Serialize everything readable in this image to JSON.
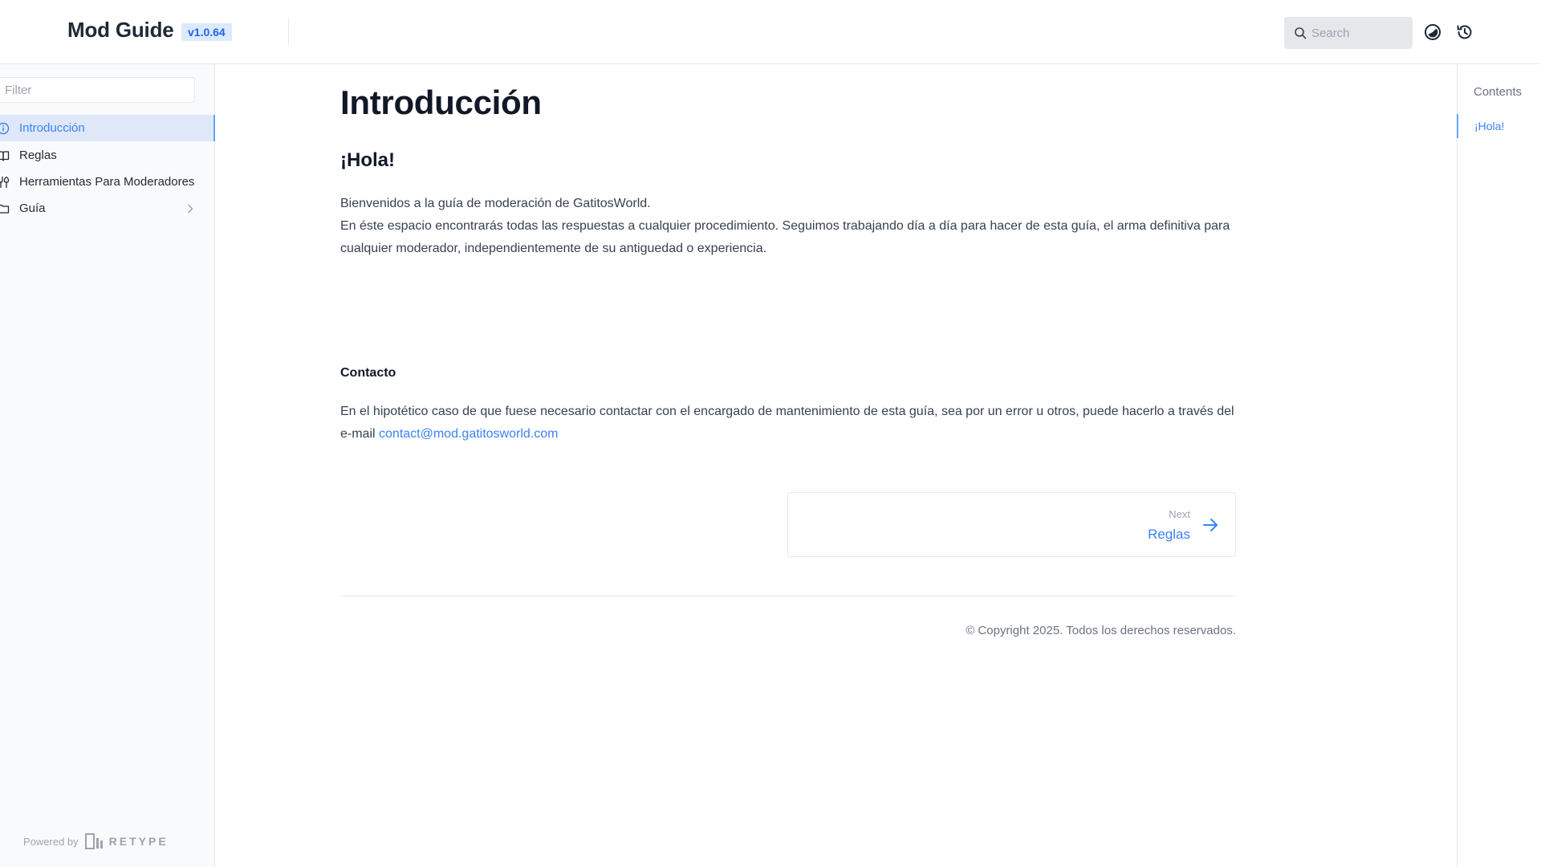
{
  "header": {
    "brand": "Mod Guide",
    "version": "v1.0.64",
    "search_placeholder": "Search",
    "icons": [
      "search-icon",
      "theme-toggle-icon",
      "history-icon"
    ]
  },
  "sidebar": {
    "filter_placeholder": "Filter",
    "items": [
      {
        "label": "Introducción",
        "icon": "info-circle-icon",
        "active": true
      },
      {
        "label": "Reglas",
        "icon": "book-icon",
        "active": false
      },
      {
        "label": "Herramientas Para Moderadores",
        "icon": "tools-icon",
        "active": false
      },
      {
        "label": "Guía",
        "icon": "folder-icon",
        "active": false,
        "has_children": true
      }
    ],
    "powered_by": "Powered by",
    "powered_brand": "RETYPE"
  },
  "content": {
    "title": "Introducción",
    "heading": "¡Hola!",
    "intro_line1": "Bienvenidos a la guía de moderación de GatitosWorld.",
    "intro_line2": "En éste espacio encontrarás todas las respuestas a cualquier procedimiento. Seguimos trabajando día a día para hacer de esta guía, el arma definitiva para cualquier moderador, independientemente de su antiguedad o experiencia.",
    "contact_heading": "Contacto",
    "contact_text": "En el hipotético caso de que fuese necesario contactar con el encargado de mantenimiento de esta guía, sea por un error u otros, puede hacerlo a través del e-mail ",
    "contact_email": "contact@mod.gatitosworld.com",
    "next_small": "Next",
    "next_label": "Reglas",
    "copyright": "© Copyright 2025. Todos los derechos reservados."
  },
  "toc": {
    "title": "Contents",
    "items": [
      "¡Hola!"
    ]
  },
  "colors": {
    "accent": "#3b82f6",
    "active_bg": "#dfe8f8",
    "badge_bg": "#dbeafe"
  }
}
